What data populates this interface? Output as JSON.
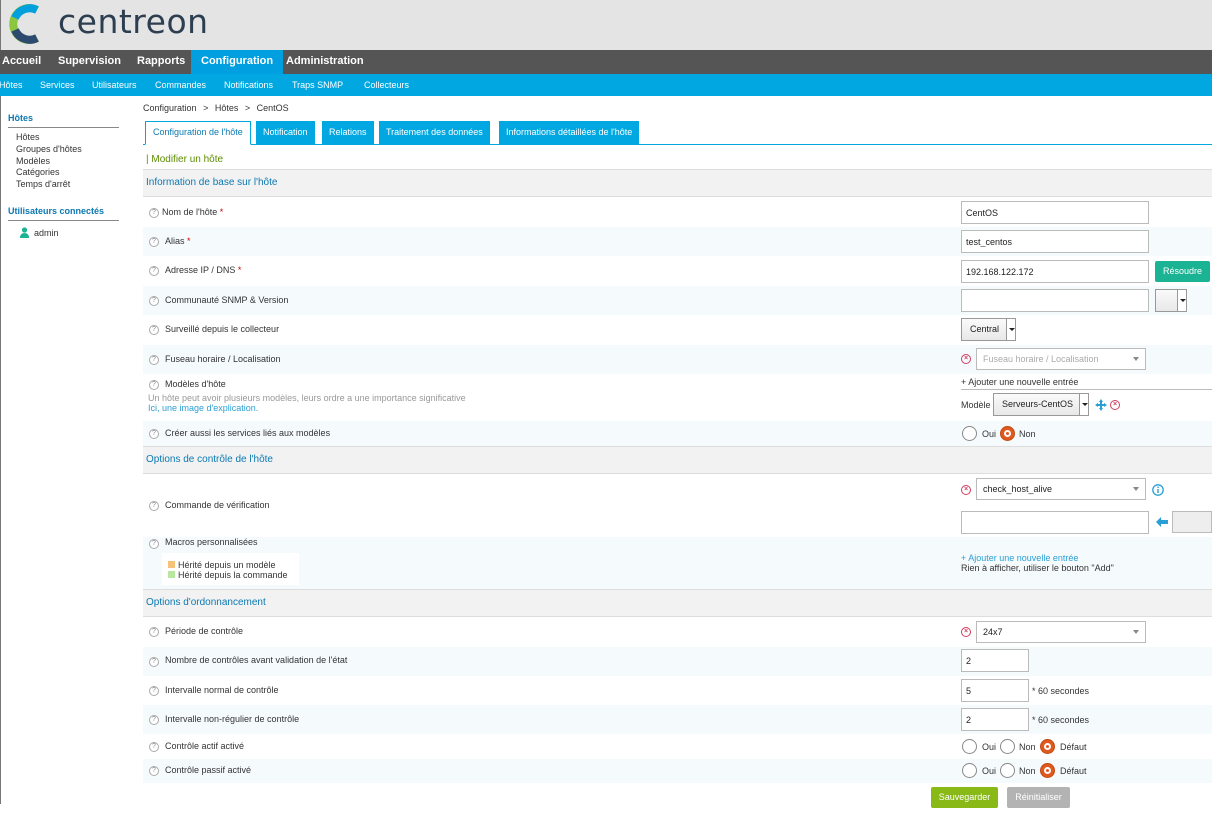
{
  "brand": {
    "name": "centreon"
  },
  "topnav": [
    "Accueil",
    "Supervision",
    "Rapports",
    "Configuration",
    "Administration"
  ],
  "subnav": [
    "Hôtes",
    "Services",
    "Utilisateurs",
    "Commandes",
    "Notifications",
    "Traps SNMP",
    "Collecteurs"
  ],
  "sidebar": {
    "title": "Hôtes",
    "links": [
      "Hôtes",
      "Groupes d'hôtes",
      "Modèles",
      "Catégories",
      "Temps d'arrêt"
    ],
    "users_title": "Utilisateurs connectés",
    "user": "admin"
  },
  "breadcrumb": [
    "Configuration",
    ">",
    "Hôtes",
    ">",
    "CentOS"
  ],
  "tabs": [
    "Configuration de l'hôte",
    "Notification",
    "Relations",
    "Traitement des données",
    "Informations détaillées de l'hôte"
  ],
  "form_title": "| Modifier un hôte",
  "sections": {
    "basic": "Information de base sur l'hôte",
    "check": "Options de contrôle de l'hôte",
    "sched": "Options d'ordonnancement"
  },
  "fields": {
    "host_name": {
      "label": "Nom de l'hôte",
      "value": "CentOS"
    },
    "alias": {
      "label": "Alias",
      "value": "test_centos"
    },
    "address": {
      "label": "Adresse IP / DNS",
      "value": "192.168.122.172",
      "button": "Résoudre"
    },
    "snmp": {
      "label": "Communauté SNMP & Version",
      "value": ""
    },
    "poller": {
      "label": "Surveillé depuis le collecteur",
      "value": "Central"
    },
    "timezone": {
      "label": "Fuseau horaire / Localisation",
      "placeholder": "Fuseau horaire / Localisation"
    },
    "templates": {
      "label": "Modèles d'hôte",
      "help": "Un hôte peut avoir plusieurs modèles, leurs ordre a une importance significative",
      "help_link": "Ici, une image d'explication.",
      "add": "+ Ajouter une nouvelle entrée",
      "model_label": "Modèle",
      "model_value": "Serveurs-CentOS"
    },
    "create_services": {
      "label": "Créer aussi les services liés aux modèles",
      "options": [
        "Oui",
        "Non"
      ],
      "selected": "Non"
    },
    "check_command": {
      "label": "Commande de vérification",
      "value": "check_host_alive",
      "args": ""
    },
    "macros": {
      "label": "Macros personnalisées",
      "legend_template": "Hérité depuis un modèle",
      "legend_command": "Hérité depuis la commande",
      "add": "+ Ajouter une nouvelle entrée",
      "empty": "Rien à afficher, utiliser le bouton \"Add\""
    },
    "check_period": {
      "label": "Période de contrôle",
      "value": "24x7"
    },
    "max_attempts": {
      "label": "Nombre de contrôles avant validation de l'état",
      "value": "2"
    },
    "normal_interval": {
      "label": "Intervalle normal de contrôle",
      "value": "5",
      "unit": "* 60 secondes"
    },
    "retry_interval": {
      "label": "Intervalle non-régulier de contrôle",
      "value": "2",
      "unit": "* 60 secondes"
    },
    "active_checks": {
      "label": "Contrôle actif activé",
      "options": [
        "Oui",
        "Non",
        "Défaut"
      ],
      "selected": "Défaut"
    },
    "passive_checks": {
      "label": "Contrôle passif activé",
      "options": [
        "Oui",
        "Non",
        "Défaut"
      ],
      "selected": "Défaut"
    }
  },
  "actions": {
    "save": "Sauvegarder",
    "reset": "Réinitialiser"
  },
  "colors": {
    "accent": "#00a7e1",
    "nav": "#555555",
    "save": "#88b917",
    "legend_template": "#f5c27a",
    "legend_command": "#b9e6a0"
  }
}
